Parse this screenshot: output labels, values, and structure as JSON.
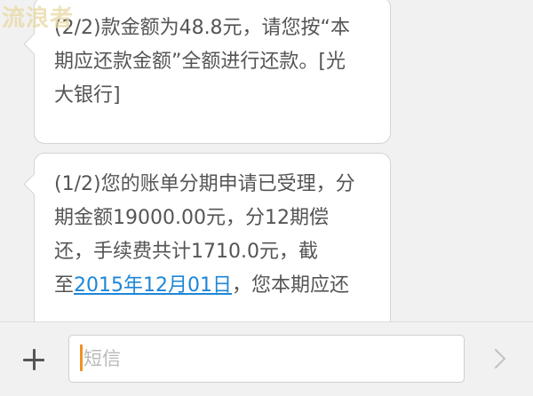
{
  "watermark": {
    "text": "流浪者"
  },
  "messages": [
    {
      "lines": [
        "(2/2)款金额为48.8元，请您按“本",
        "期应还款金额”全额进行还款。[光",
        "大银行]"
      ]
    },
    {
      "lines": [
        "(1/2)您的账单分期申请已受理，分",
        "期金额19000.00元，分12期偿",
        "还，手续费共计1710.0元，截"
      ],
      "last_line_prefix": "至",
      "date_link": "2015年12月01日",
      "last_line_suffix": "，您本期应还"
    }
  ],
  "composer": {
    "add_icon": "plus-icon",
    "placeholder": "短信",
    "value": "",
    "send_icon": "chevron-right-icon"
  },
  "colors": {
    "link": "#1f86d6",
    "caret": "#f09224",
    "bubble_border": "#d4d4d4",
    "background": "#f1f1f1"
  }
}
